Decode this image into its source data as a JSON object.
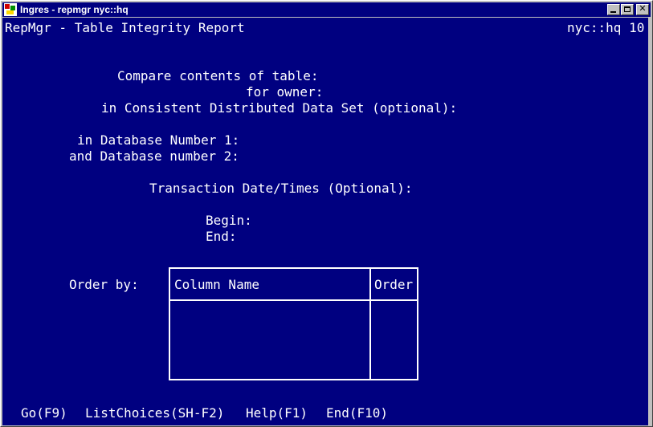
{
  "window": {
    "title": "Ingres - repmgr nyc::hq",
    "icon": "ingres-app-icon",
    "controls": [
      "minimize-icon",
      "maximize-icon",
      "close-icon"
    ]
  },
  "header": {
    "left": "RepMgr - Table Integrity Report",
    "right": "nyc::hq 10"
  },
  "form": {
    "compare_label": "Compare contents of table:",
    "owner_label": "for owner:",
    "cdds_label": "in Consistent Distributed Data Set (optional):",
    "db1_label": "in Database Number 1:",
    "db2_label": "and Database number 2:",
    "transaction_label": "Transaction Date/Times (Optional):",
    "begin_label": "Begin:",
    "end_label": "End:",
    "order_by_label": "Order by:"
  },
  "order_table": {
    "columns": [
      "Column Name",
      "Order"
    ],
    "rows": []
  },
  "menu": [
    {
      "label": "Go(F9)"
    },
    {
      "label": "ListChoices(SH-F2)"
    },
    {
      "label": "Help(F1)"
    },
    {
      "label": "End(F10)"
    }
  ],
  "colors": {
    "background": "#000080",
    "text": "#ffffff",
    "titlebar": "#000080",
    "chrome": "#c0c0c0"
  }
}
